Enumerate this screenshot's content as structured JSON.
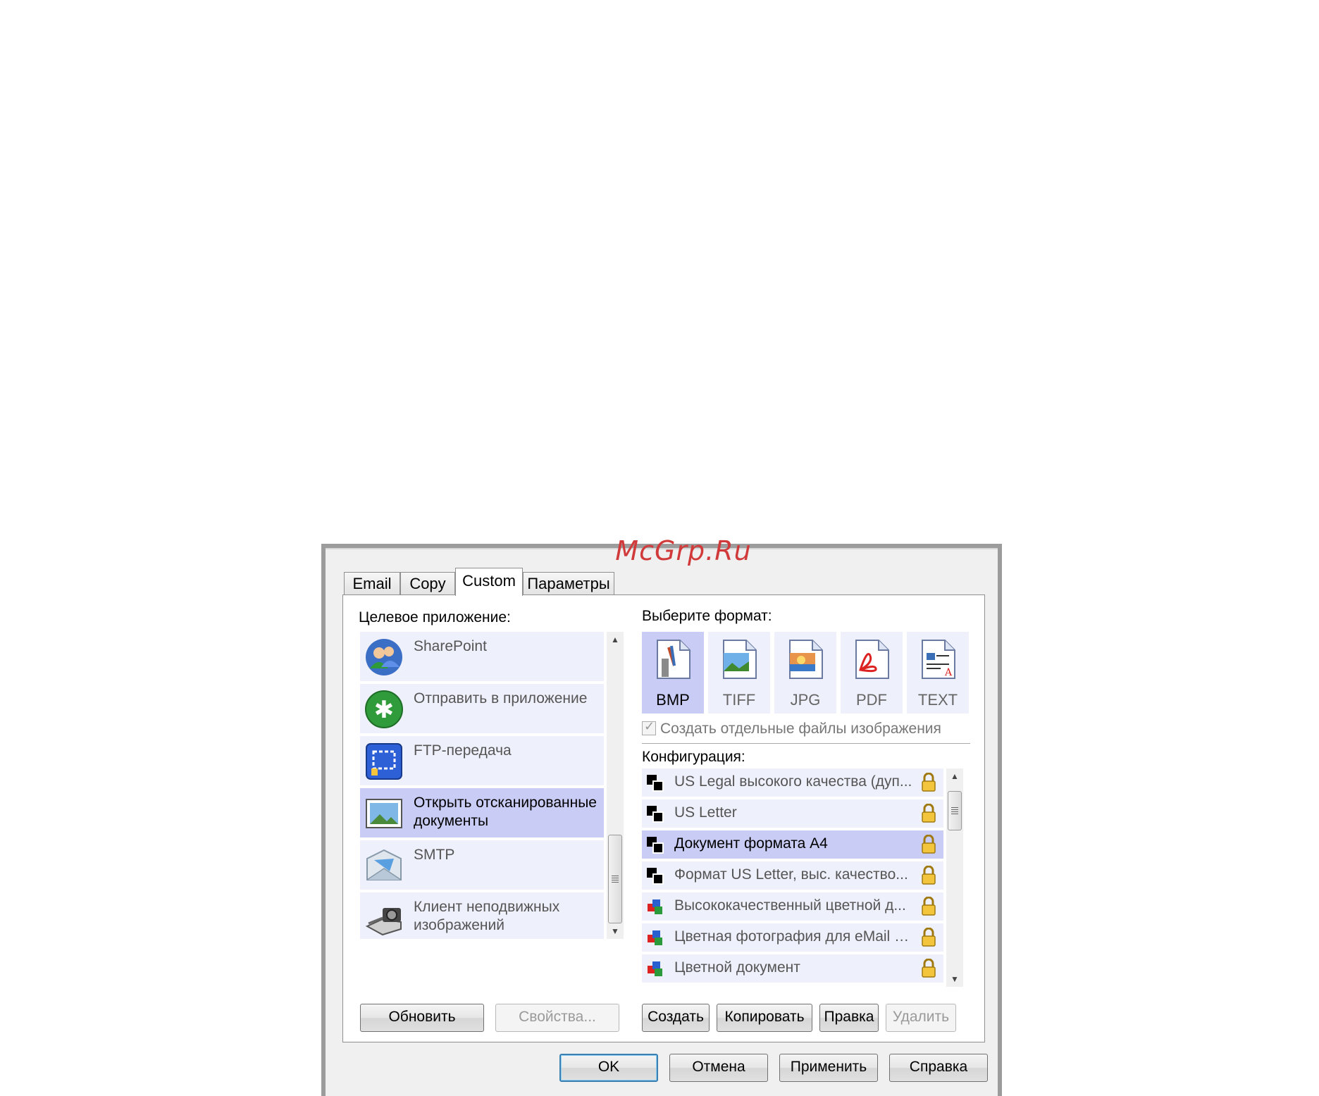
{
  "watermark": "McGrp.Ru",
  "tabs": [
    {
      "label": "Email"
    },
    {
      "label": "Copy"
    },
    {
      "label": "Custom"
    },
    {
      "label": "Параметры"
    }
  ],
  "target": {
    "label": "Целевое приложение:",
    "items": [
      {
        "label": "SharePoint",
        "icon": "sharepoint-icon"
      },
      {
        "label": "Отправить в приложение",
        "icon": "send-to-application-icon"
      },
      {
        "label": "FTP-передача",
        "icon": "ftp-icon"
      },
      {
        "label": "Открыть отсканированные документы",
        "icon": "open-scanned-documents-icon",
        "selected": true
      },
      {
        "label": "SMTP",
        "icon": "smtp-envelope-icon"
      },
      {
        "label": "Клиент неподвижных изображений",
        "icon": "still-image-client-icon"
      }
    ]
  },
  "format": {
    "label": "Выберите формат:",
    "items": [
      {
        "label": "BMP",
        "selected": true
      },
      {
        "label": "TIFF"
      },
      {
        "label": "JPG"
      },
      {
        "label": "PDF"
      },
      {
        "label": "TEXT"
      }
    ],
    "separate_files_label": "Создать отдельные файлы изображения"
  },
  "config": {
    "label": "Конфигурация:",
    "items": [
      {
        "label": "US Legal высокого качества (дуп...",
        "kind": "bw"
      },
      {
        "label": "US Letter",
        "kind": "bw"
      },
      {
        "label": "Документ формата A4",
        "kind": "bw",
        "selected": true
      },
      {
        "label": "Формат US Letter, выс. качество...",
        "kind": "bw"
      },
      {
        "label": "Высококачественный цветной д...",
        "kind": "color"
      },
      {
        "label": "Цветная фотография для eMail (6...",
        "kind": "color"
      },
      {
        "label": "Цветной документ",
        "kind": "color"
      }
    ]
  },
  "buttons": {
    "refresh": "Обновить",
    "properties": "Свойства...",
    "create": "Создать",
    "copy": "Копировать",
    "edit": "Правка",
    "delete": "Удалить",
    "ok": "OK",
    "cancel": "Отмена",
    "apply": "Применить",
    "help": "Справка"
  }
}
